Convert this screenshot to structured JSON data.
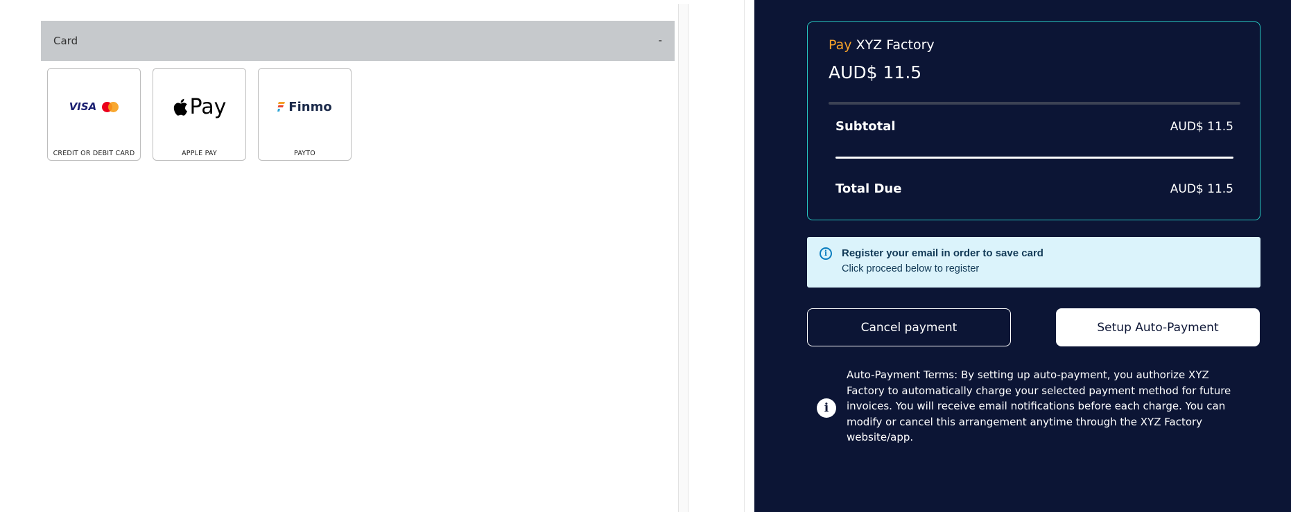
{
  "accordion": {
    "title": "Card",
    "toggle": "-"
  },
  "payment_methods": [
    {
      "caption": "CREDIT OR DEBIT CARD",
      "logo_text": "VISA",
      "icons": [
        "visa-icon",
        "mastercard-icon"
      ]
    },
    {
      "caption": "APPLE PAY",
      "logo_text": "Pay",
      "icons": [
        "apple-icon"
      ]
    },
    {
      "caption": "PAYTO",
      "logo_text": "Finmo",
      "icons": [
        "finmo-icon"
      ]
    }
  ],
  "summary": {
    "pay_word": "Pay",
    "merchant": "XYZ Factory",
    "amount": "AUD$ 11.5",
    "subtotal_label": "Subtotal",
    "subtotal_value": "AUD$ 11.5",
    "total_label": "Total Due",
    "total_value": "AUD$ 11.5"
  },
  "info_banner": {
    "icon": "info-icon",
    "title": "Register your email in order to save card",
    "subtitle": "Click proceed below to register"
  },
  "buttons": {
    "cancel": "Cancel payment",
    "setup": "Setup Auto-Payment"
  },
  "terms": {
    "icon": "info-icon",
    "text": "Auto-Payment Terms: By setting up auto-payment, you authorize XYZ Factory to automatically charge your selected payment method for future invoices. You will receive email notifications before each charge. You can modify or cancel this arrangement anytime through the XYZ Factory website/app."
  },
  "colors": {
    "panel_bg": "#0c1535",
    "accent_teal": "#26c6c0",
    "accent_orange": "#f5a12a",
    "info_bg": "#dbf3fb",
    "accordion_bg": "#c6c9cc"
  }
}
